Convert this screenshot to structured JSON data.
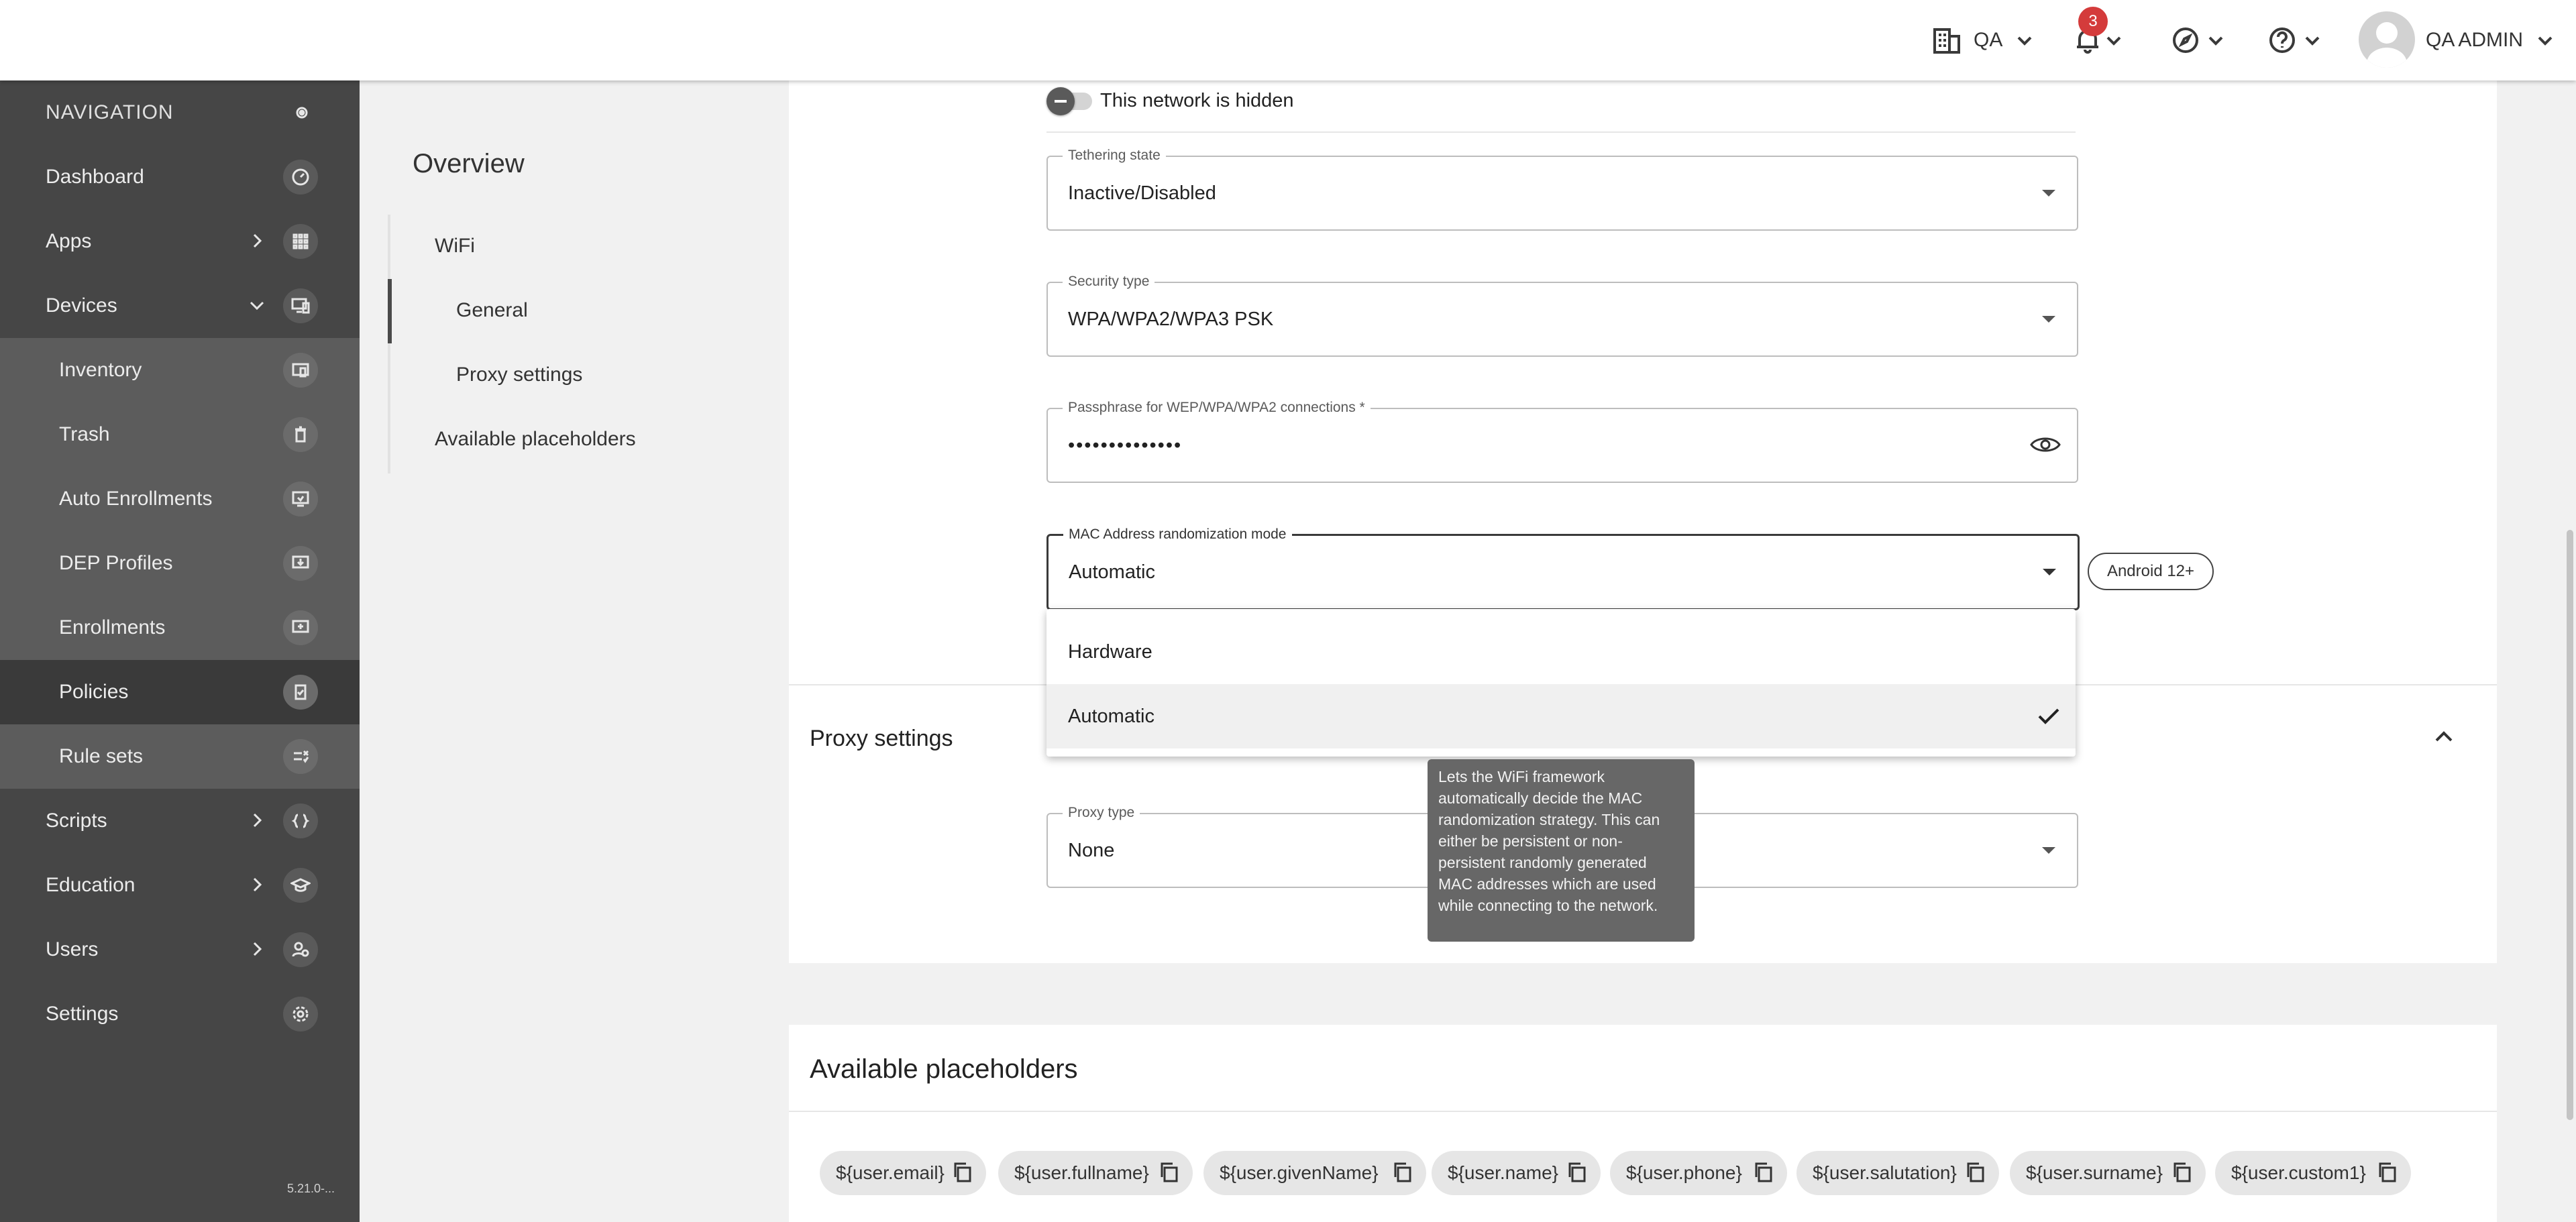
{
  "topbar": {
    "org_label": "QA",
    "notifications_count": "3",
    "user_name": "QA ADMIN"
  },
  "sidebar": {
    "header": "NAVIGATION",
    "items": [
      {
        "label": "Dashboard",
        "icon": "speedometer-icon"
      },
      {
        "label": "Apps",
        "icon": "grid-icon"
      },
      {
        "label": "Devices",
        "icon": "devices-icon"
      },
      {
        "label": "Inventory",
        "icon": "inventory-icon"
      },
      {
        "label": "Trash",
        "icon": "trash-icon"
      },
      {
        "label": "Auto Enrollments",
        "icon": "auto-enroll-icon"
      },
      {
        "label": "DEP Profiles",
        "icon": "dep-profile-icon"
      },
      {
        "label": "Enrollments",
        "icon": "enrollment-icon"
      },
      {
        "label": "Policies",
        "icon": "policy-icon"
      },
      {
        "label": "Rule sets",
        "icon": "rules-icon"
      },
      {
        "label": "Scripts",
        "icon": "code-icon"
      },
      {
        "label": "Education",
        "icon": "graduation-cap-icon"
      },
      {
        "label": "Users",
        "icon": "users-icon"
      },
      {
        "label": "Settings",
        "icon": "gear-icon"
      }
    ],
    "version": "5.21.0-..."
  },
  "overview": {
    "title": "Overview",
    "items": [
      "WiFi",
      "General",
      "Proxy settings",
      "Available placeholders"
    ]
  },
  "wifi": {
    "hidden_label": "This network is hidden",
    "tethering": {
      "label": "Tethering state",
      "value": "Inactive/Disabled"
    },
    "security": {
      "label": "Security type",
      "value": "WPA/WPA2/WPA3 PSK"
    },
    "passphrase": {
      "label": "Passphrase for WEP/WPA/WPA2 connections *",
      "value": "••••••••••••••"
    },
    "mac": {
      "label": "MAC Address randomization mode",
      "value": "Automatic",
      "badge": "Android 12+"
    },
    "mac_options": [
      "Hardware",
      "Automatic"
    ],
    "tooltip": "Lets the WiFi framework automatically decide the MAC randomization strategy. This can either be persistent or non-persistent randomly generated MAC addresses which are used while connecting to the network."
  },
  "proxy": {
    "title": "Proxy settings",
    "type": {
      "label": "Proxy type",
      "value": "None"
    }
  },
  "placeholders": {
    "title": "Available placeholders",
    "chips": [
      "${user.email}",
      "${user.fullname}",
      "${user.givenName}",
      "${user.name}",
      "${user.phone}",
      "${user.salutation}",
      "${user.surname}",
      "${user.custom1}"
    ]
  }
}
